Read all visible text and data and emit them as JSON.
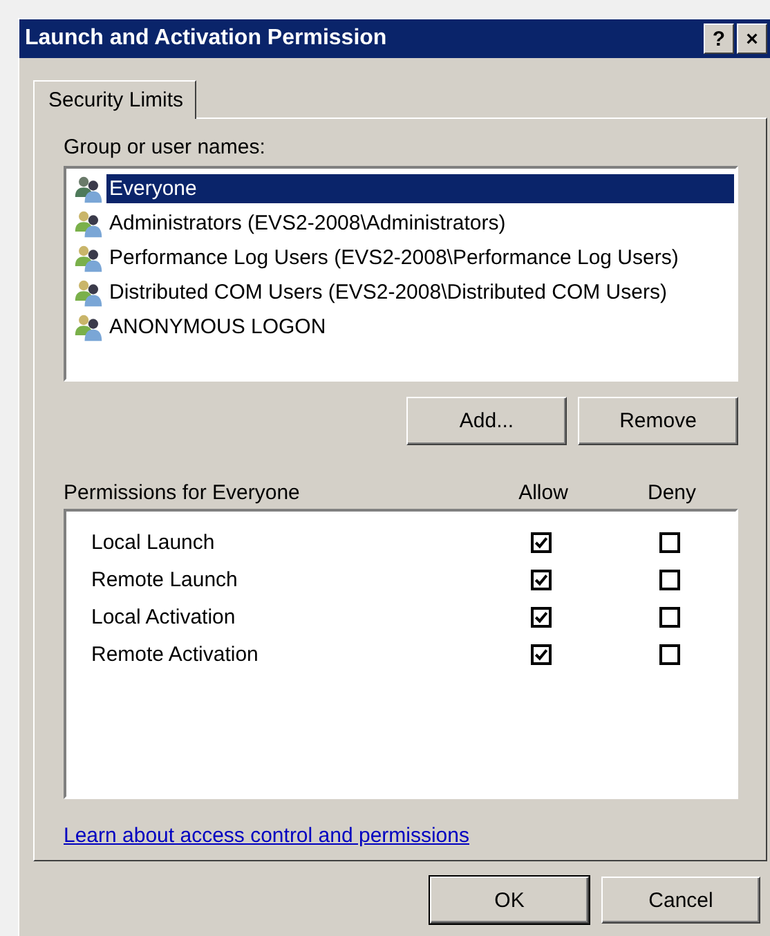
{
  "window": {
    "title": "Launch and Activation Permission",
    "buttons": [
      "?",
      "×"
    ]
  },
  "tabs": [
    {
      "label": "Security Limits",
      "selected": true
    }
  ],
  "group_label": "Group or user names:",
  "users": [
    {
      "name": "Everyone",
      "selected": true
    },
    {
      "name": "Administrators (EVS2-2008\\Administrators)",
      "selected": false
    },
    {
      "name": "Performance Log Users (EVS2-2008\\Performance Log Users)",
      "selected": false
    },
    {
      "name": "Distributed COM Users (EVS2-2008\\Distributed COM Users)",
      "selected": false
    },
    {
      "name": "ANONYMOUS LOGON",
      "selected": false
    }
  ],
  "user_buttons": [
    "Add...",
    "Remove"
  ],
  "permissions": {
    "label": "Permissions for Everyone",
    "columns": [
      "Allow",
      "Deny"
    ],
    "rows": [
      {
        "name": "Local Launch",
        "allow": true,
        "deny": false
      },
      {
        "name": "Remote Launch",
        "allow": true,
        "deny": false
      },
      {
        "name": "Local Activation",
        "allow": true,
        "deny": false
      },
      {
        "name": "Remote Activation",
        "allow": true,
        "deny": false
      }
    ]
  },
  "link": "Learn about access control and permissions",
  "buttons": [
    "OK",
    "Cancel"
  ]
}
